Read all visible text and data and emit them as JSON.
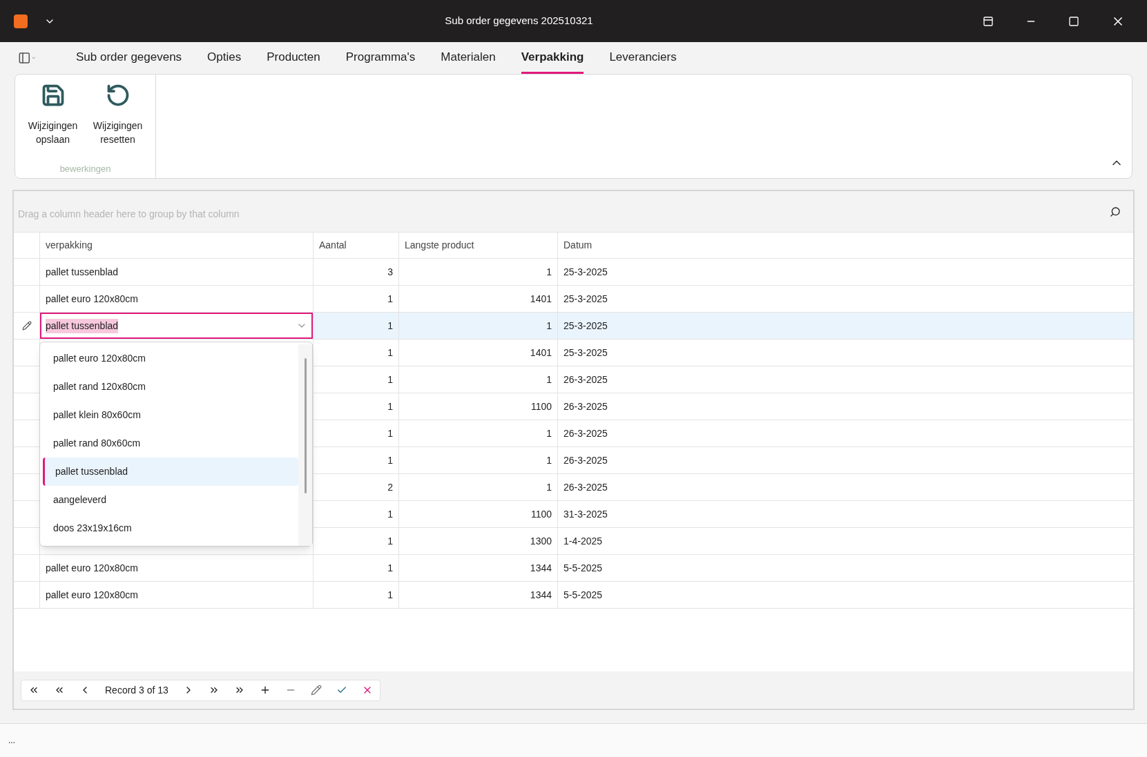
{
  "window": {
    "title": "Sub order gegevens 202510321"
  },
  "tabs": [
    {
      "label": "Sub order gegevens",
      "selected": false
    },
    {
      "label": "Opties",
      "selected": false
    },
    {
      "label": "Producten",
      "selected": false
    },
    {
      "label": "Programma's",
      "selected": false
    },
    {
      "label": "Materialen",
      "selected": false
    },
    {
      "label": "Verpakking",
      "selected": true
    },
    {
      "label": "Leveranciers",
      "selected": false
    }
  ],
  "ribbon": {
    "buttons": [
      {
        "kind": "save",
        "label": "Wijzigingen opslaan"
      },
      {
        "kind": "reset",
        "label": "Wijzigingen resetten"
      }
    ],
    "group_label": "bewerkingen"
  },
  "grid": {
    "group_panel": {
      "placeholder": "Drag a column header here to group by that column"
    },
    "columns": [
      "verpakking",
      "Aantal",
      "Langste product",
      "Datum"
    ],
    "rows": [
      {
        "verpakking": "pallet tussenblad",
        "aantal": "3",
        "langste": "1",
        "datum": "25-3-2025",
        "selected": false
      },
      {
        "verpakking": "pallet euro 120x80cm",
        "aantal": "1",
        "langste": "1401",
        "datum": "25-3-2025",
        "selected": false
      },
      {
        "verpakking": "pallet tussenblad",
        "aantal": "1",
        "langste": "1",
        "datum": "25-3-2025",
        "selected": true
      },
      {
        "aantal": "1",
        "langste": "1401",
        "datum": "25-3-2025",
        "selected": false
      },
      {
        "aantal": "1",
        "langste": "1",
        "datum": "26-3-2025",
        "selected": false
      },
      {
        "aantal": "1",
        "langste": "1100",
        "datum": "26-3-2025",
        "selected": false
      },
      {
        "aantal": "1",
        "langste": "1",
        "datum": "26-3-2025",
        "selected": false
      },
      {
        "aantal": "1",
        "langste": "1",
        "datum": "26-3-2025",
        "selected": false
      },
      {
        "aantal": "2",
        "langste": "1",
        "datum": "26-3-2025",
        "selected": false
      },
      {
        "aantal": "1",
        "langste": "1100",
        "datum": "31-3-2025",
        "selected": false
      },
      {
        "aantal": "1",
        "langste": "1300",
        "datum": "1-4-2025",
        "selected": false
      },
      {
        "verpakking": "pallet euro 120x80cm",
        "aantal": "1",
        "langste": "1344",
        "datum": "5-5-2025",
        "selected": false
      },
      {
        "verpakking": "pallet euro 120x80cm",
        "aantal": "1",
        "langste": "1344",
        "datum": "5-5-2025",
        "selected": false
      }
    ],
    "dropdown": [
      {
        "label": "pallet euro 120x80cm",
        "selected": false
      },
      {
        "label": "pallet rand 120x80cm",
        "selected": false
      },
      {
        "label": "pallet klein 80x60cm",
        "selected": false
      },
      {
        "label": "pallet rand 80x60cm",
        "selected": false
      },
      {
        "label": "pallet tussenblad",
        "selected": true
      },
      {
        "label": "aangeleverd",
        "selected": false
      },
      {
        "label": "doos 23x19x16cm",
        "selected": false
      }
    ],
    "pager": {
      "record": "Record 3 of 13"
    }
  },
  "status_bar": {
    "text": "..."
  }
}
